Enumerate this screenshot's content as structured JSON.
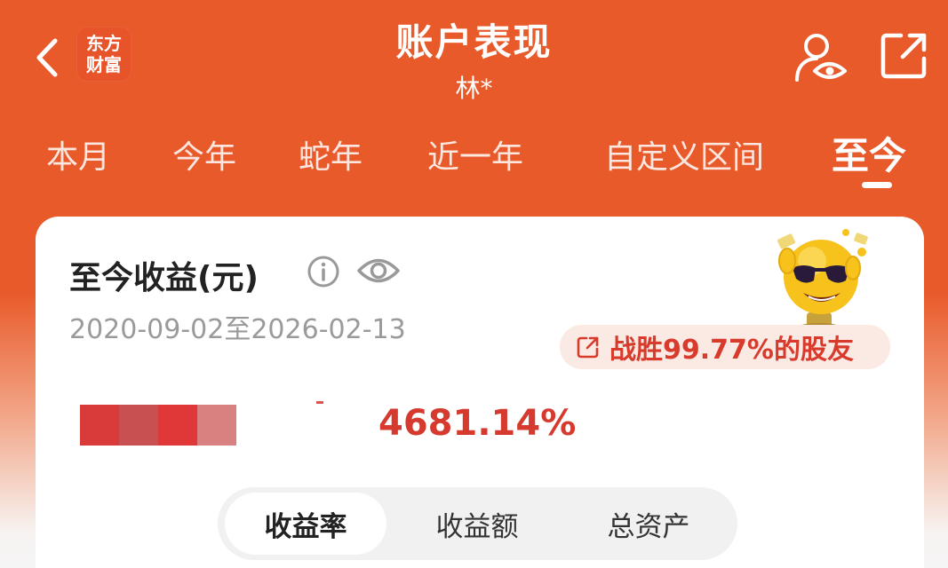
{
  "header": {
    "title": "账户表现",
    "subtitle": "林*",
    "logo_line1": "东方",
    "logo_line2": "财富"
  },
  "tabs": [
    {
      "label": "本月"
    },
    {
      "label": "今年"
    },
    {
      "label": "蛇年"
    },
    {
      "label": "近一年"
    },
    {
      "label": "自定义区间"
    },
    {
      "label": "至今",
      "active": true
    }
  ],
  "card": {
    "title": "至今收益(元)",
    "date_range": "2020-09-02至2026-02-13",
    "beat_text": "战胜99.77%的股友",
    "return_value": "4681.14%"
  },
  "segments": [
    {
      "label": "收益率",
      "active": true
    },
    {
      "label": "收益额"
    },
    {
      "label": "总资产"
    }
  ],
  "colors": {
    "brand_orange": "#e95a2a",
    "accent_red": "#d63a2f",
    "badge_bg": "#fbe9e4"
  },
  "icons": {
    "back": "chevron-left-icon",
    "user_view": "user-eye-icon",
    "share": "share-external-icon",
    "info": "info-icon",
    "visibility": "eye-icon",
    "badge": "share-square-icon"
  }
}
